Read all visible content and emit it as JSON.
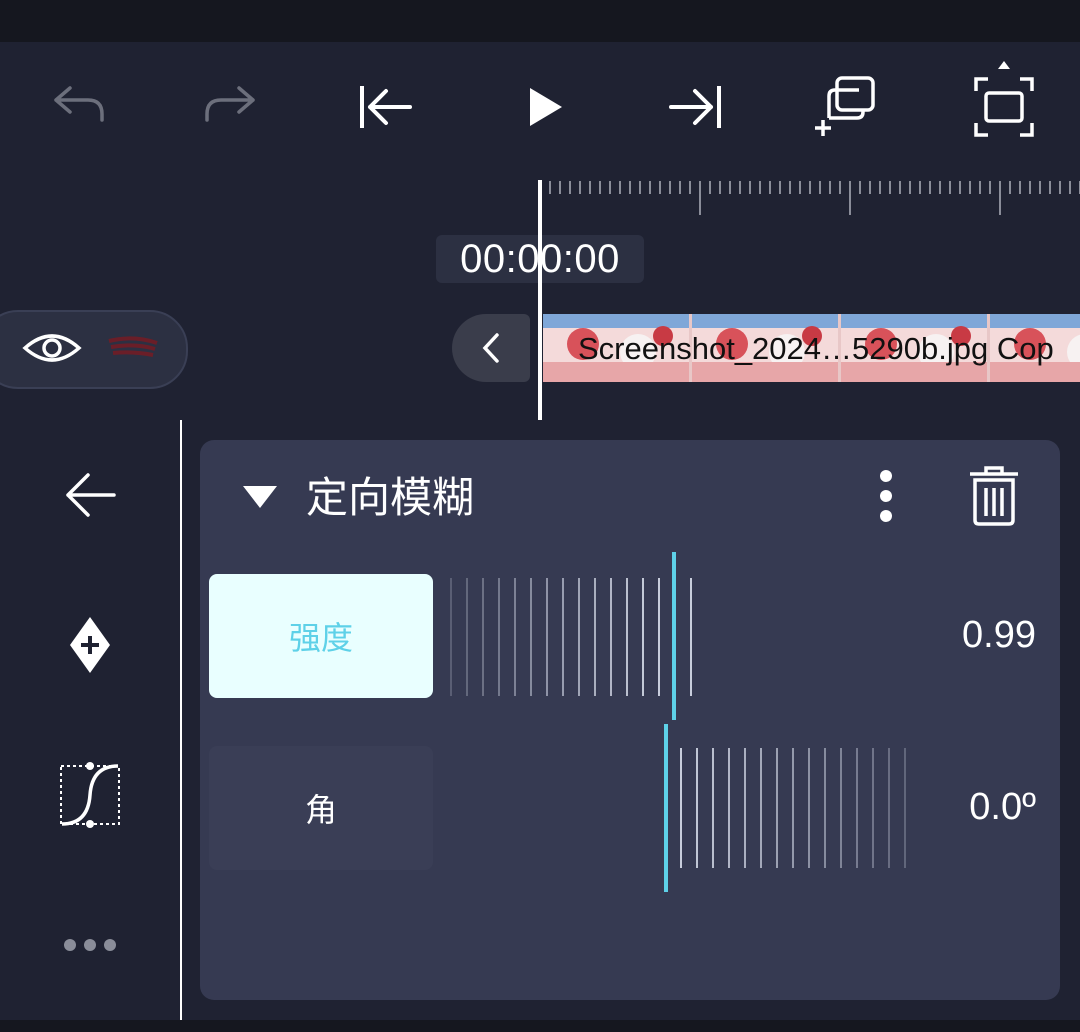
{
  "toolbar": {
    "buttons": [
      {
        "name": "undo-icon",
        "enabled": false
      },
      {
        "name": "redo-icon",
        "enabled": false
      },
      {
        "name": "skip-to-start-icon",
        "enabled": true
      },
      {
        "name": "play-icon",
        "enabled": true
      },
      {
        "name": "skip-to-end-icon",
        "enabled": true
      },
      {
        "name": "add-layer-icon",
        "enabled": true
      },
      {
        "name": "fullscreen-icon",
        "enabled": true
      }
    ]
  },
  "timeline": {
    "timecode": "00:00:00",
    "clip_label": "Screenshot_2024…5290b.jpg Cop"
  },
  "track": {
    "visibility_icon": "eye-icon"
  },
  "side_rail": {
    "items": [
      "back-arrow-icon",
      "add-keyframe-icon",
      "easing-curve-icon",
      "more-dots-icon"
    ]
  },
  "effect": {
    "title": "定向模糊",
    "params": [
      {
        "label": "强度",
        "value": "0.99",
        "selected": true
      },
      {
        "label": "角",
        "value": "0.0º",
        "selected": false
      }
    ]
  },
  "colors": {
    "background": "#1f2232",
    "panel": "#363a52",
    "accent": "#5ed1e8",
    "selected_label_bg": "#e9ffff"
  }
}
